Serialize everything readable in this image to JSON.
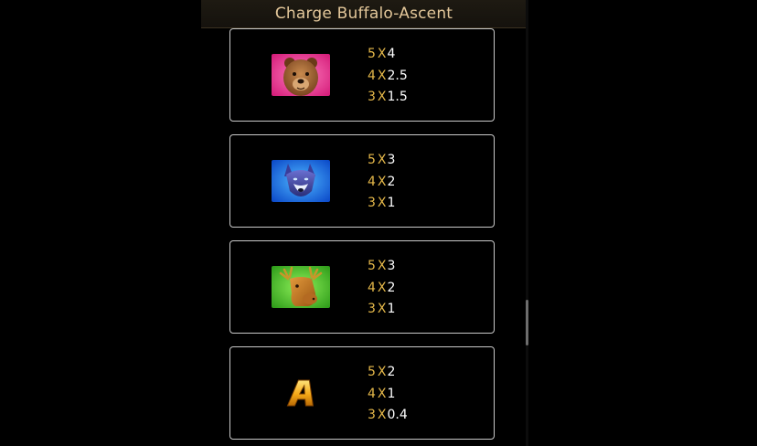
{
  "header": {
    "title": "Charge Buffalo-Ascent"
  },
  "x_symbol": "X",
  "colors": {
    "count": "#e6b94a",
    "multiplier": "#ffffff",
    "title": "#e3c79a",
    "card_border": "#c9c9c9"
  },
  "paytable": [
    {
      "symbol": "bear-icon",
      "rows": [
        {
          "count": "5",
          "value": "4"
        },
        {
          "count": "4",
          "value": "2.5"
        },
        {
          "count": "3",
          "value": "1.5"
        }
      ]
    },
    {
      "symbol": "wolf-icon",
      "rows": [
        {
          "count": "5",
          "value": "3"
        },
        {
          "count": "4",
          "value": "2"
        },
        {
          "count": "3",
          "value": "1"
        }
      ]
    },
    {
      "symbol": "moose-icon",
      "rows": [
        {
          "count": "5",
          "value": "3"
        },
        {
          "count": "4",
          "value": "2"
        },
        {
          "count": "3",
          "value": "1"
        }
      ]
    },
    {
      "symbol": "letter-a-icon",
      "rows": [
        {
          "count": "5",
          "value": "2"
        },
        {
          "count": "4",
          "value": "1"
        },
        {
          "count": "3",
          "value": "0.4"
        }
      ]
    }
  ]
}
